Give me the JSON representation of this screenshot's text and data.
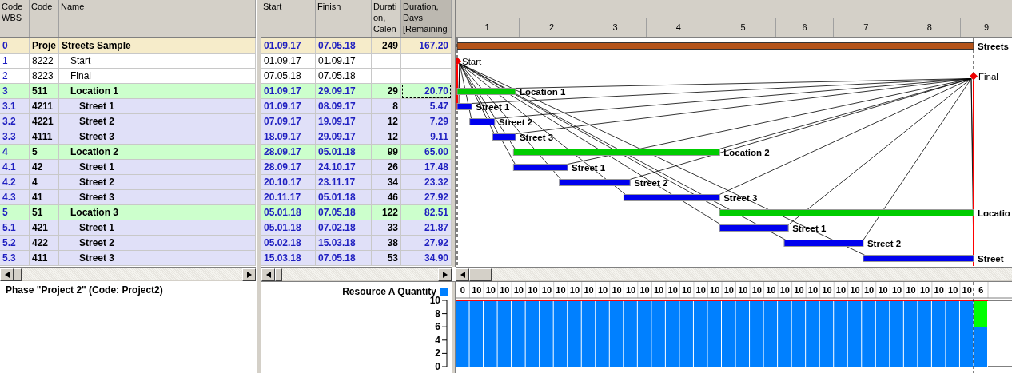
{
  "table": {
    "columns": [
      {
        "label": "Code WBS",
        "selected": false
      },
      {
        "label": "Code",
        "selected": false
      },
      {
        "label": "Name",
        "selected": false
      },
      {
        "label": "Start",
        "selected": false
      },
      {
        "label": "Finish",
        "selected": false
      },
      {
        "label": "Duration, Calen",
        "selected": false
      },
      {
        "label": "Duration, Days [Remaining",
        "selected": true
      }
    ],
    "rows": [
      {
        "wbs": "0",
        "code": "Proje",
        "name": "Streets Sample",
        "start": "01.09.17",
        "finish": "07.05.18",
        "duration": "249",
        "remaining": "167.20",
        "kind": "project",
        "selected": false,
        "children": [
          {
            "wbs": "1",
            "code": "8222",
            "name": "Start",
            "start": "01.09.17",
            "finish": "01.09.17",
            "kind": "milestone",
            "selected": false
          },
          {
            "wbs": "2",
            "code": "8223",
            "name": "Final",
            "start": "07.05.18",
            "finish": "07.05.18",
            "kind": "milestone",
            "selected": false
          },
          {
            "wbs": "3",
            "code": "511",
            "name": "Location 1",
            "start": "01.09.17",
            "finish": "29.09.17",
            "duration": "29",
            "remaining": "20.70",
            "kind": "location",
            "selected": true,
            "children": [
              {
                "wbs": "3.1",
                "code": "4211",
                "name": "Street 1",
                "start": "01.09.17",
                "finish": "08.09.17",
                "duration": "8",
                "remaining": "5.47",
                "kind": "street",
                "selected": false
              },
              {
                "wbs": "3.2",
                "code": "4221",
                "name": "Street 2",
                "start": "07.09.17",
                "finish": "19.09.17",
                "duration": "12",
                "remaining": "7.29",
                "kind": "street",
                "selected": false
              },
              {
                "wbs": "3.3",
                "code": "4111",
                "name": "Street 3",
                "start": "18.09.17",
                "finish": "29.09.17",
                "duration": "12",
                "remaining": "9.11",
                "kind": "street",
                "selected": false
              }
            ]
          },
          {
            "wbs": "4",
            "code": "5",
            "name": "Location 2",
            "start": "28.09.17",
            "finish": "05.01.18",
            "duration": "99",
            "remaining": "65.00",
            "kind": "location",
            "selected": false,
            "children": [
              {
                "wbs": "4.1",
                "code": "42",
                "name": "Street 1",
                "start": "28.09.17",
                "finish": "24.10.17",
                "duration": "26",
                "remaining": "17.48",
                "kind": "street",
                "selected": false
              },
              {
                "wbs": "4.2",
                "code": "4",
                "name": "Street 2",
                "start": "20.10.17",
                "finish": "23.11.17",
                "duration": "34",
                "remaining": "23.32",
                "kind": "street",
                "selected": false
              },
              {
                "wbs": "4.3",
                "code": "41",
                "name": "Street 3",
                "start": "20.11.17",
                "finish": "05.01.18",
                "duration": "46",
                "remaining": "27.92",
                "kind": "street",
                "selected": false
              }
            ]
          },
          {
            "wbs": "5",
            "code": "51",
            "name": "Location 3",
            "start": "05.01.18",
            "finish": "07.05.18",
            "duration": "122",
            "remaining": "82.51",
            "kind": "location",
            "selected": false,
            "children": [
              {
                "wbs": "5.1",
                "code": "421",
                "name": "Street 1",
                "start": "05.01.18",
                "finish": "07.02.18",
                "duration": "33",
                "remaining": "21.87",
                "kind": "street",
                "selected": false
              },
              {
                "wbs": "5.2",
                "code": "422",
                "name": "Street 2",
                "start": "05.02.18",
                "finish": "15.03.18",
                "duration": "38",
                "remaining": "27.92",
                "kind": "street",
                "selected": false
              },
              {
                "wbs": "5.3",
                "code": "411",
                "name": "Street 3",
                "start": "15.03.18",
                "finish": "07.05.18",
                "duration": "53",
                "remaining": "34.90",
                "kind": "street",
                "selected": false
              }
            ]
          }
        ]
      }
    ]
  },
  "gantt": {
    "timescale": [
      "1",
      "2",
      "3",
      "4",
      "5",
      "6",
      "7",
      "8",
      "9"
    ],
    "bar_labels": [
      "Streets",
      "Start",
      "Final",
      "Location 1",
      "Street 1",
      "Street 2",
      "Street 3",
      "Location 2",
      "Street 1",
      "Street 2",
      "Street 3",
      "Locatio",
      "Street 1",
      "Street 2",
      "Street"
    ]
  },
  "phase_info": "Phase \"Project 2\" (Code: Project2)",
  "histogram": {
    "chart_data": {
      "type": "bar",
      "stacked": true,
      "ylim": [
        0,
        10
      ],
      "yticks": [
        0,
        2,
        4,
        6,
        8,
        10
      ],
      "value_labels": [
        "0",
        "10",
        "10",
        "10",
        "10",
        "10",
        "10",
        "10",
        "10",
        "10",
        "10",
        "10",
        "10",
        "10",
        "10",
        "10",
        "10",
        "10",
        "10",
        "10",
        "10",
        "10",
        "10",
        "10",
        "10",
        "10",
        "10",
        "10",
        "10",
        "10",
        "10",
        "10",
        "10",
        "10",
        "10",
        "10",
        "10",
        "6"
      ],
      "series": [
        {
          "name": "Resource A Quantity",
          "color": "#0080ff",
          "values": [
            10,
            10,
            10,
            10,
            10,
            10,
            10,
            10,
            10,
            10,
            10,
            10,
            10,
            10,
            10,
            10,
            10,
            10,
            10,
            10,
            10,
            10,
            10,
            10,
            10,
            10,
            10,
            10,
            10,
            10,
            10,
            10,
            10,
            10,
            10,
            10,
            10,
            6
          ]
        },
        {
          "color": "#00ff00",
          "values": [
            null,
            null,
            null,
            null,
            null,
            null,
            null,
            null,
            null,
            null,
            null,
            null,
            null,
            null,
            null,
            null,
            null,
            null,
            null,
            null,
            null,
            null,
            null,
            null,
            null,
            null,
            null,
            null,
            null,
            null,
            null,
            null,
            null,
            null,
            null,
            null,
            null,
            4
          ]
        }
      ]
    }
  }
}
